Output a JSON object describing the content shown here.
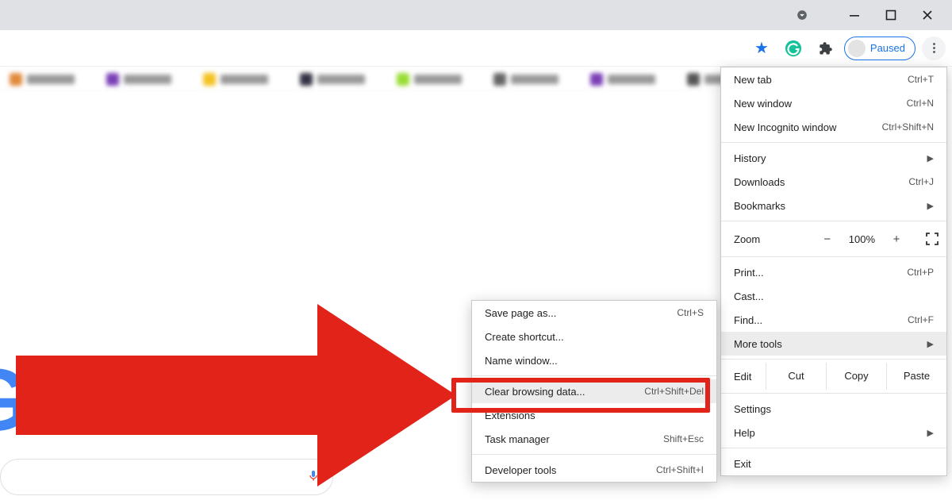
{
  "titlebar": {
    "minimize_label": "Minimize",
    "maximize_label": "Maximize",
    "close_label": "Close"
  },
  "toolbar": {
    "star_tooltip": "Bookmark this tab",
    "grammarly_tooltip": "Grammarly",
    "extensions_tooltip": "Extensions",
    "profile_state": "Paused",
    "menu_tooltip": "Customize and control Google Chrome"
  },
  "page": {
    "logo_fragment": "G",
    "mic_tooltip": "Search by voice"
  },
  "menu": {
    "items_a": [
      {
        "label": "New tab",
        "shortcut": "Ctrl+T"
      },
      {
        "label": "New window",
        "shortcut": "Ctrl+N"
      },
      {
        "label": "New Incognito window",
        "shortcut": "Ctrl+Shift+N"
      }
    ],
    "items_b": [
      {
        "label": "History",
        "submenu": true
      },
      {
        "label": "Downloads",
        "shortcut": "Ctrl+J"
      },
      {
        "label": "Bookmarks",
        "submenu": true
      }
    ],
    "zoom": {
      "label": "Zoom",
      "minus": "−",
      "level": "100%",
      "plus": "+"
    },
    "items_c": [
      {
        "label": "Print...",
        "shortcut": "Ctrl+P"
      },
      {
        "label": "Cast..."
      },
      {
        "label": "Find...",
        "shortcut": "Ctrl+F"
      },
      {
        "label": "More tools",
        "submenu": true,
        "hover": true
      }
    ],
    "edit": {
      "label": "Edit",
      "cut": "Cut",
      "copy": "Copy",
      "paste": "Paste"
    },
    "items_d": [
      {
        "label": "Settings"
      },
      {
        "label": "Help",
        "submenu": true
      }
    ],
    "items_e": [
      {
        "label": "Exit"
      }
    ]
  },
  "submenu": {
    "items_a": [
      {
        "label": "Save page as...",
        "shortcut": "Ctrl+S"
      },
      {
        "label": "Create shortcut..."
      },
      {
        "label": "Name window..."
      }
    ],
    "items_b": [
      {
        "label": "Clear browsing data...",
        "shortcut": "Ctrl+Shift+Del",
        "hover": true
      },
      {
        "label": "Extensions"
      },
      {
        "label": "Task manager",
        "shortcut": "Shift+Esc"
      }
    ],
    "items_c": [
      {
        "label": "Developer tools",
        "shortcut": "Ctrl+Shift+I"
      }
    ]
  }
}
